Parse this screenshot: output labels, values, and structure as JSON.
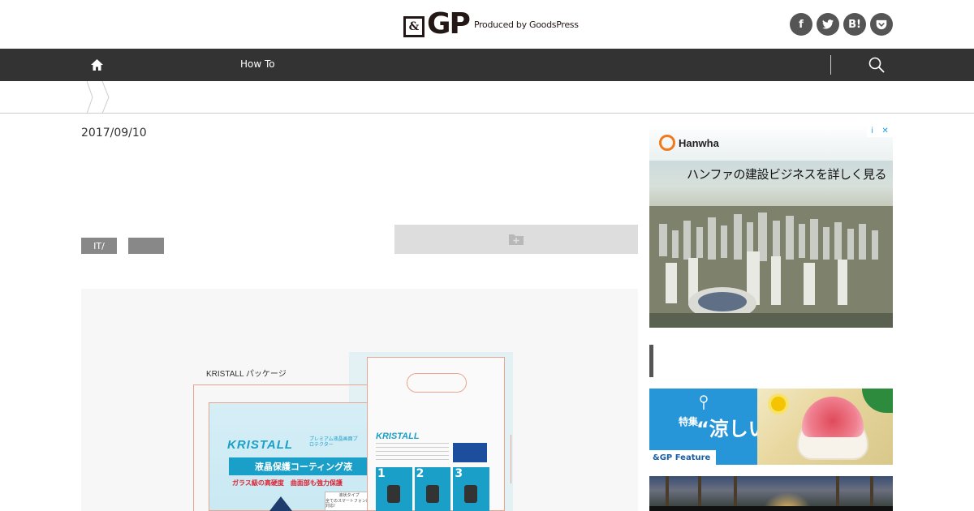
{
  "header": {
    "logo_box": "&",
    "logo_gp": "GP",
    "logo_tagline": "Produced by GoodsPress",
    "social": [
      {
        "icon": "facebook-icon",
        "glyph": "f"
      },
      {
        "icon": "twitter-icon",
        "glyph": "t"
      },
      {
        "icon": "hatena-bookmark-icon",
        "glyph": "B!"
      },
      {
        "icon": "pocket-icon",
        "glyph": "p"
      }
    ]
  },
  "nav": {
    "link": "How To"
  },
  "article": {
    "date": "2017/09/10",
    "tags": [
      "IT/",
      ""
    ],
    "image": {
      "package_label": "KRISTALL パッケージ",
      "brand": "KRISTALL",
      "sub": "プレミアム液晶画面プロテクター",
      "band": "液晶保護コーティング液",
      "red_line": "ガラス級の高硬度　曲面部も強力保護",
      "badge_line1": "液状タイプ",
      "badge_line2": "全てのスマートフォンに対応!",
      "steps": [
        "1",
        "2",
        "3"
      ]
    }
  },
  "sidebar": {
    "ad": {
      "brand": "Hanwha",
      "headline": "ハンファの建設ビジネスを詳しく見る",
      "choice_info": "i",
      "choice_close": "✕"
    },
    "feature": {
      "prefix": "特集",
      "title": "“涼しい”",
      "label": "&GP Feature"
    }
  },
  "colors": {
    "nav_bg": "#333333",
    "tag_bg": "#888888",
    "feature_blue": "#2796d9",
    "kristall_blue": "#1aa0c8",
    "hanwha_orange": "#f27a1a"
  }
}
